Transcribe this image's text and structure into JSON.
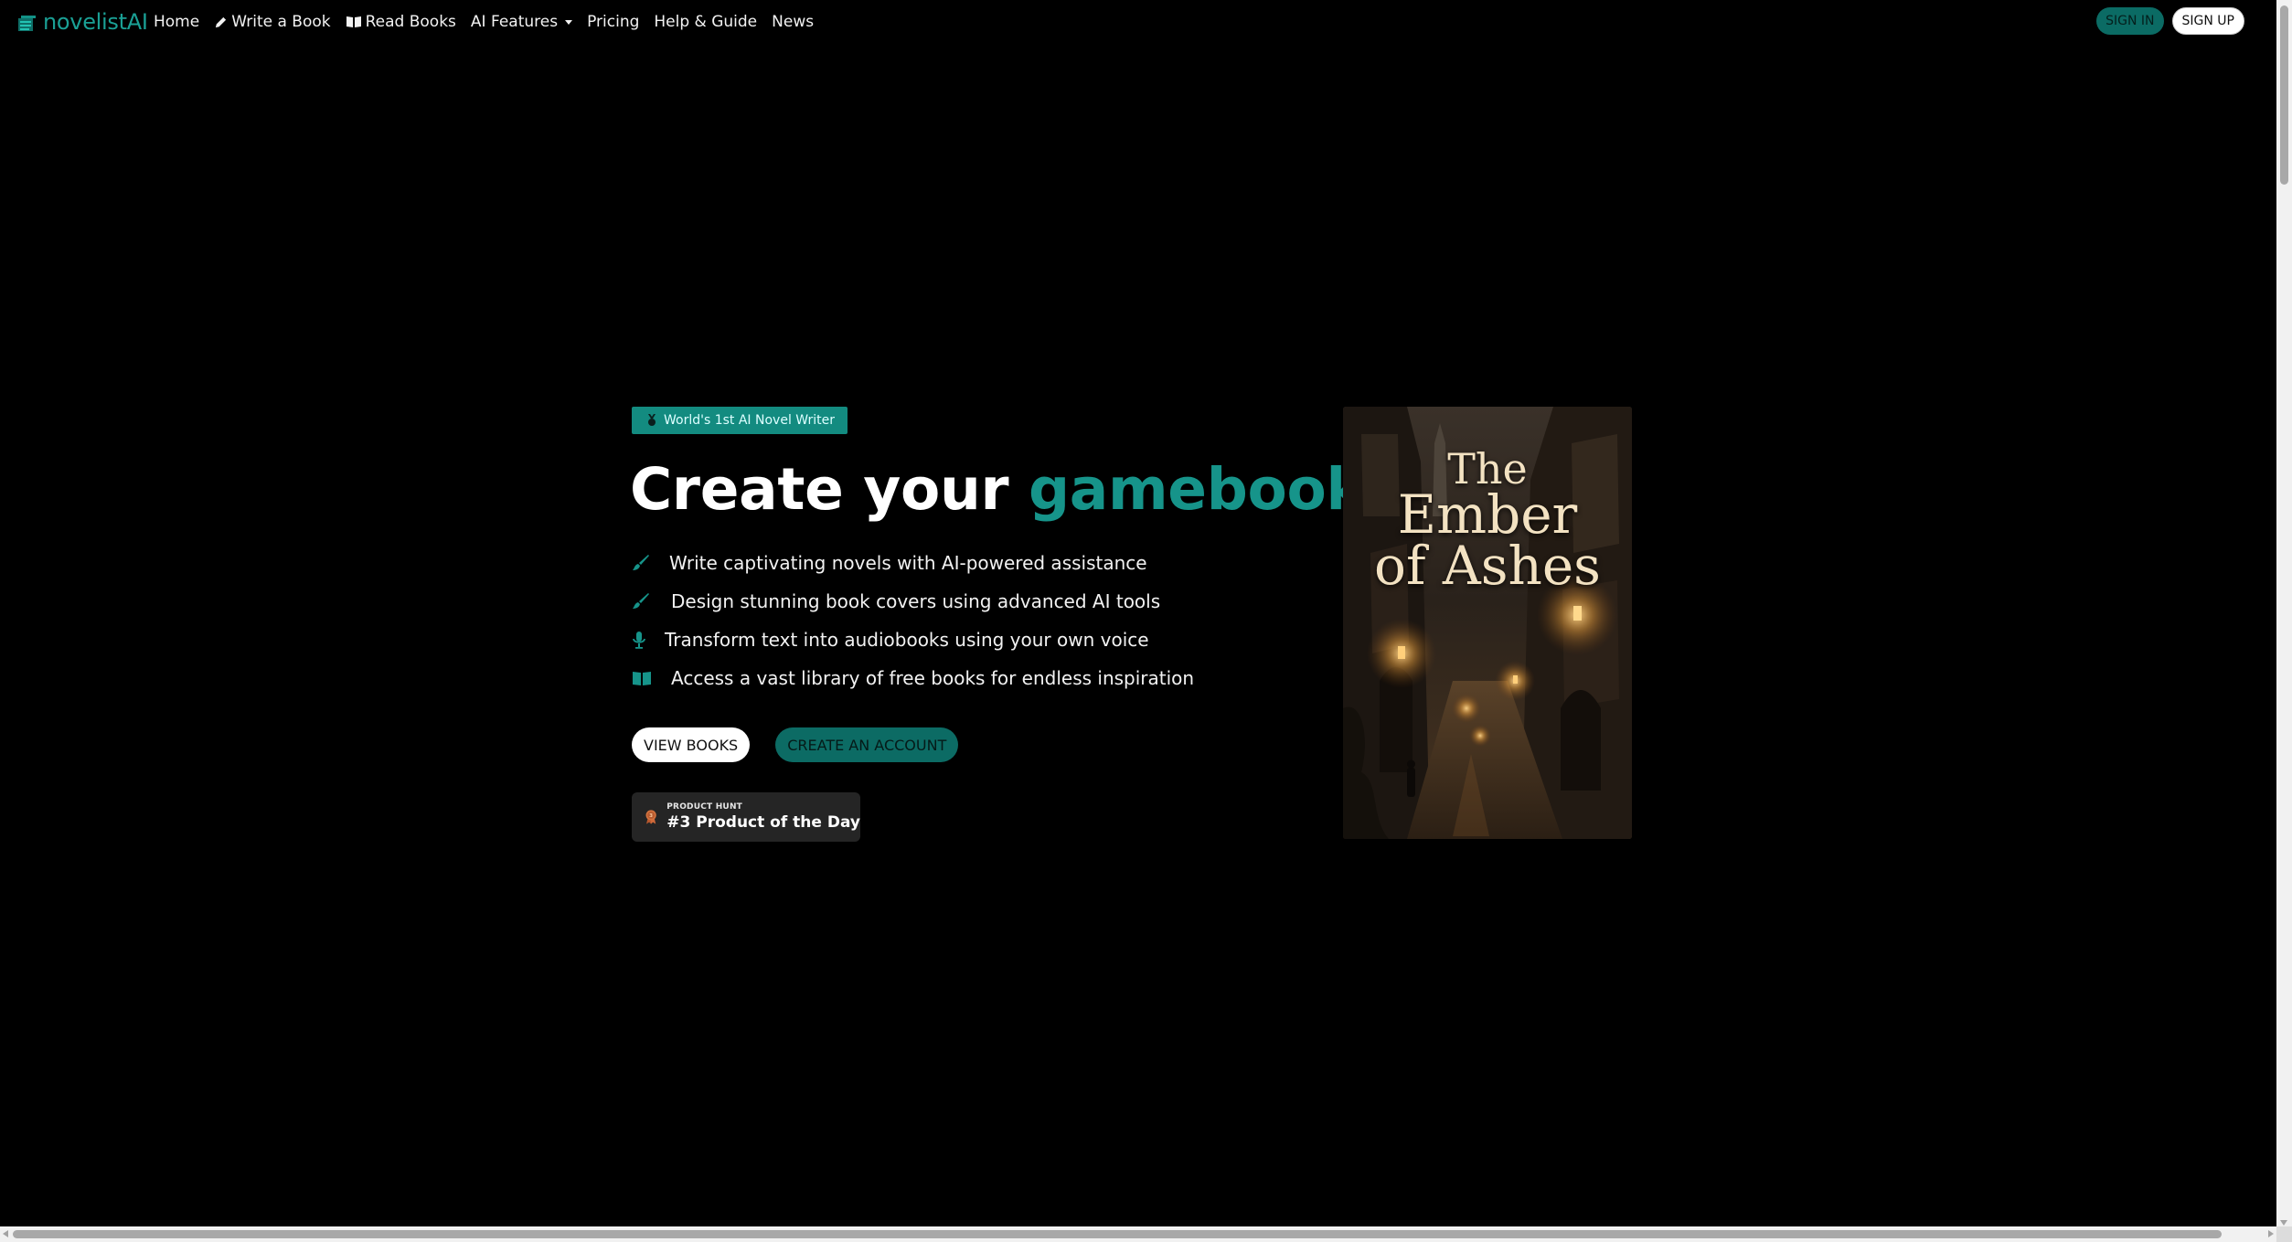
{
  "nav": {
    "brand": "novelistAI",
    "links": [
      {
        "label": "Home",
        "icon": null
      },
      {
        "label": "Write a Book",
        "icon": "pencil-icon"
      },
      {
        "label": "Read Books",
        "icon": "open-book-icon"
      },
      {
        "label": "AI Features",
        "icon": "chevron-down-icon"
      },
      {
        "label": "Pricing",
        "icon": null
      },
      {
        "label": "Help & Guide",
        "icon": null
      },
      {
        "label": "News",
        "icon": null
      }
    ],
    "sign_in": "SIGN IN",
    "sign_up": "SIGN UP"
  },
  "hero": {
    "badge": "World's 1st AI Novel Writer",
    "headline_prefix": "Create your",
    "headline_accent": "gamebooks",
    "features": [
      {
        "icon": "brush-icon",
        "text": "Write captivating novels with AI-powered assistance"
      },
      {
        "icon": "brush-icon",
        "text": "Design stunning book covers using advanced AI tools"
      },
      {
        "icon": "microphone-icon",
        "text": "Transform text into audiobooks using your own voice"
      },
      {
        "icon": "book-icon",
        "text": "Access a vast library of free books for endless inspiration"
      }
    ],
    "view_books": "VIEW BOOKS",
    "create_account": "CREATE AN ACCOUNT",
    "product_hunt": {
      "label": "PRODUCT HUNT",
      "title": "#3 Product of the Day"
    }
  },
  "cover": {
    "line1": "The",
    "line2": "Ember",
    "line3": "of Ashes"
  },
  "colors": {
    "accent": "#16948a",
    "background": "#000000",
    "badge": "#138b80"
  }
}
